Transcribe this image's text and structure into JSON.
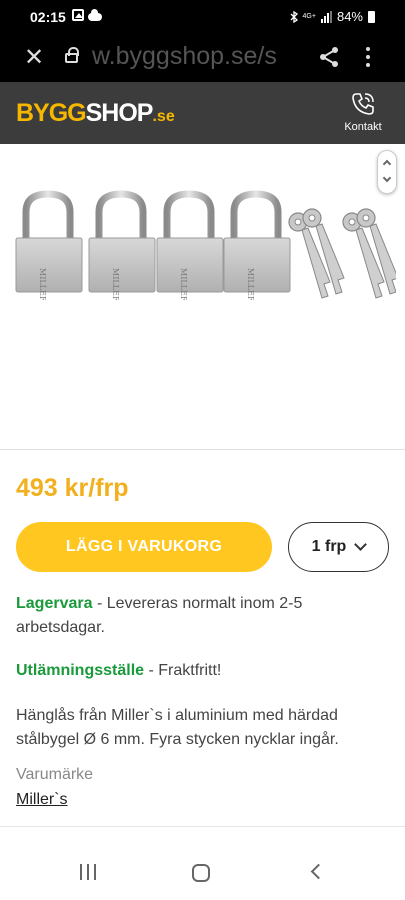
{
  "status": {
    "time": "02:15",
    "network": "4G+",
    "battery": "84%"
  },
  "browser": {
    "url": "w.byggshop.se/s"
  },
  "header": {
    "logo_part1": "BYGG",
    "logo_part2": "SHOP",
    "logo_part3": ".se",
    "contact_label": "Kontakt"
  },
  "product": {
    "image_lock_brand": "MILLER'S",
    "price": "493 kr/frp",
    "add_to_cart": "LÄGG I VARUKORG",
    "quantity": "1 frp",
    "stock_label": "Lagervara",
    "stock_text": " - Levereras normalt inom 2-5 arbetsdagar.",
    "pickup_label": "Utlämningsställe",
    "pickup_text": " - Fraktfritt!",
    "description": "Hänglås från Miller`s i aluminium med härdad stålbygel Ø 6 mm. Fyra stycken nycklar ingår.",
    "brand_label": "Varumärke",
    "brand_value": "Miller`s"
  },
  "colors": {
    "accent": "#ffc720",
    "price": "#f2b01e",
    "green": "#1a9a3b",
    "header_bg": "#3c3c3c"
  }
}
